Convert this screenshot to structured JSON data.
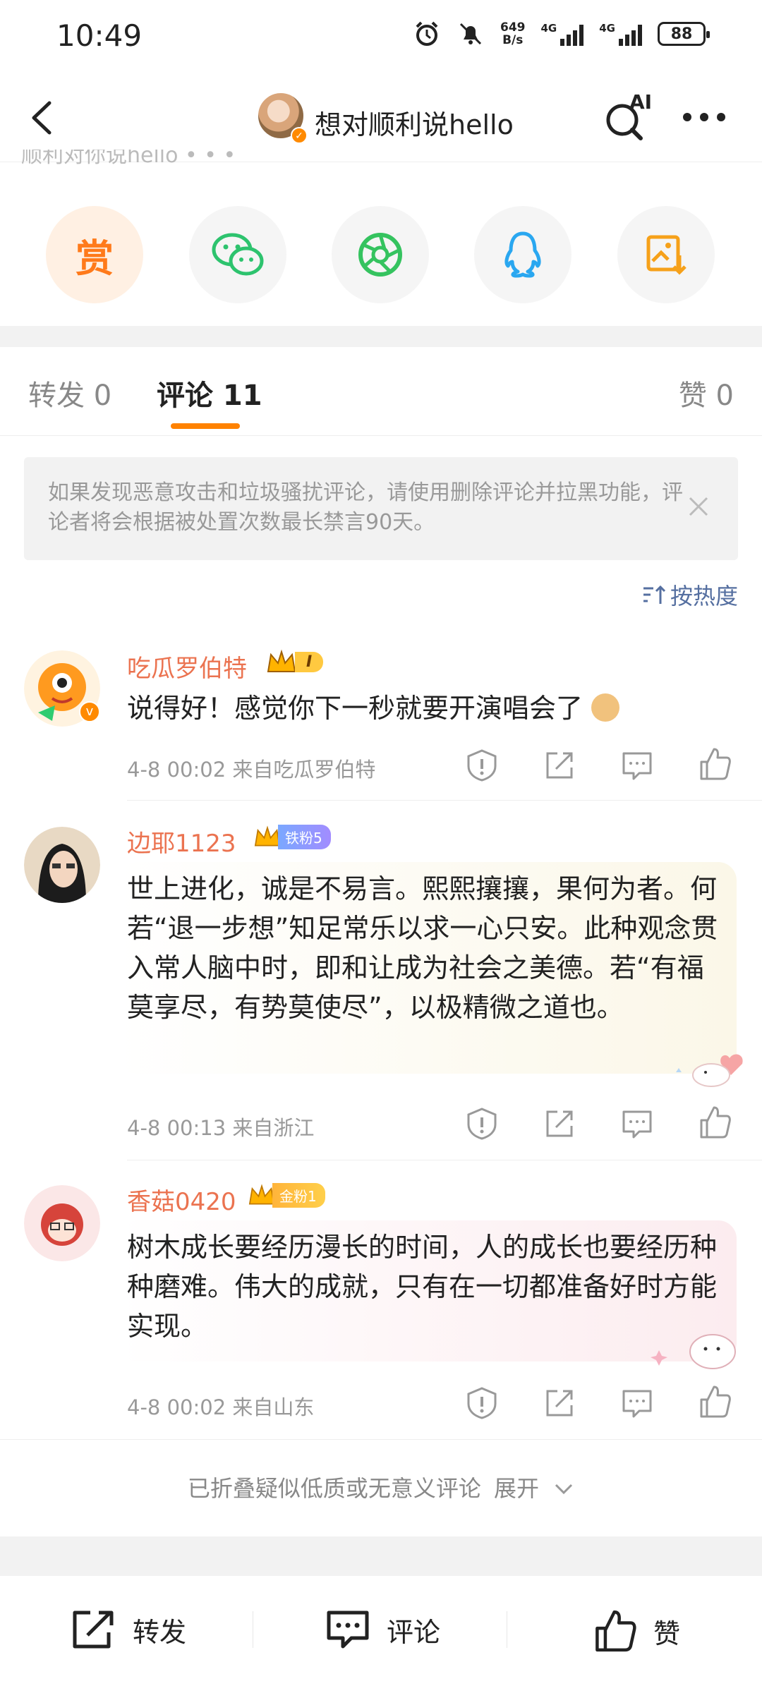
{
  "status_bar": {
    "time": "10:49",
    "net_speed_top": "649",
    "net_speed_bottom": "B/s",
    "sig1": "4G",
    "sig2": "4G",
    "battery": "88"
  },
  "header": {
    "title": "想对顺利说hello",
    "ai_label": "AI",
    "clipped_text": "顺利对你说hello • • •"
  },
  "share": {
    "reward_label": "赏"
  },
  "tabs": {
    "repost": "转发 0",
    "comment": "评论 11",
    "like": "赞 0"
  },
  "notice": {
    "text": "如果发现恶意攻击和垃圾骚扰评论，请使用删除评论并拉黑功能，评论者将会根据被处置次数最长禁言90天。"
  },
  "sort": {
    "label": "按热度"
  },
  "comments": [
    {
      "name": "吃瓜罗伯特",
      "badge": "I",
      "text": "说得好！感觉你下一秒就要开演唱会了",
      "meta": "4-8 00:02 来自吃瓜罗伯特"
    },
    {
      "name": "边耶1123",
      "badge": "铁粉5",
      "text": "世上进化，诚是不易言。熙熙攘攘，果何为者。何若“退一步想”知足常乐以求一心只安。此种观念贯入常人脑中时，即和让成为社会之美德。若“有福莫享尽，有势莫使尽”，以极精微之道也。",
      "meta": "4-8 00:13 来自浙江"
    },
    {
      "name": "香菇0420",
      "badge": "金粉1",
      "text": "树木成长要经历漫长的时间，人的成长也要经历种种磨难。伟大的成就，只有在一切都准备好时方能实现。",
      "meta": "4-8 00:02 来自山东"
    }
  ],
  "folded": {
    "text": "已折叠疑似低质或无意义评论",
    "expand": "展开"
  },
  "bottom_bar": {
    "repost": "转发",
    "comment": "评论",
    "like": "赞"
  },
  "colors": {
    "accent": "#ff8200",
    "name": "#eb7350",
    "link": "#556fa0"
  }
}
